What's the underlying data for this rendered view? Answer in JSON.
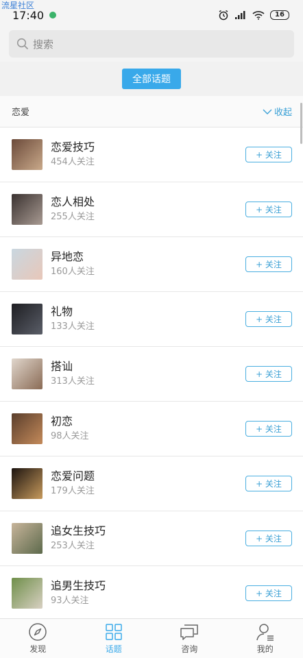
{
  "watermark": "流星社区",
  "status_bar": {
    "time": "17:40",
    "battery": "16"
  },
  "search": {
    "placeholder": "搜索"
  },
  "all_topics_label": "全部话题",
  "category": {
    "title": "恋爱",
    "collapse_label": "收起"
  },
  "topics": [
    {
      "name": "恋爱技巧",
      "followers": "454人关注",
      "follow_label": "+ 关注",
      "thumb_colors": [
        "#6b4a3a",
        "#c9a98a"
      ]
    },
    {
      "name": "恋人相处",
      "followers": "255人关注",
      "follow_label": "+ 关注",
      "thumb_colors": [
        "#3a3230",
        "#a89a92"
      ]
    },
    {
      "name": "异地恋",
      "followers": "160人关注",
      "follow_label": "+ 关注",
      "thumb_colors": [
        "#c9d7e0",
        "#e8c7b9"
      ]
    },
    {
      "name": "礼物",
      "followers": "133人关注",
      "follow_label": "+ 关注",
      "thumb_colors": [
        "#1e1e22",
        "#5a5e68"
      ]
    },
    {
      "name": "搭讪",
      "followers": "313人关注",
      "follow_label": "+ 关注",
      "thumb_colors": [
        "#e0d6cc",
        "#8a6b55"
      ]
    },
    {
      "name": "初恋",
      "followers": "98人关注",
      "follow_label": "+ 关注",
      "thumb_colors": [
        "#5a3e2c",
        "#c48a5a"
      ]
    },
    {
      "name": "恋爱问题",
      "followers": "179人关注",
      "follow_label": "+ 关注",
      "thumb_colors": [
        "#1c1410",
        "#c79a5c"
      ]
    },
    {
      "name": "追女生技巧",
      "followers": "253人关注",
      "follow_label": "+ 关注",
      "thumb_colors": [
        "#c7b49a",
        "#5d6a4c"
      ]
    },
    {
      "name": "追男生技巧",
      "followers": "93人关注",
      "follow_label": "+ 关注",
      "thumb_colors": [
        "#6f8f4a",
        "#d8d0c2"
      ]
    }
  ],
  "bottom_nav": [
    {
      "label": "发现",
      "icon": "compass-icon"
    },
    {
      "label": "话题",
      "icon": "grid-icon"
    },
    {
      "label": "咨询",
      "icon": "chat-icon"
    },
    {
      "label": "我的",
      "icon": "user-icon"
    }
  ],
  "colors": {
    "accent": "#39a9ea",
    "follow_border": "#49aee0"
  }
}
